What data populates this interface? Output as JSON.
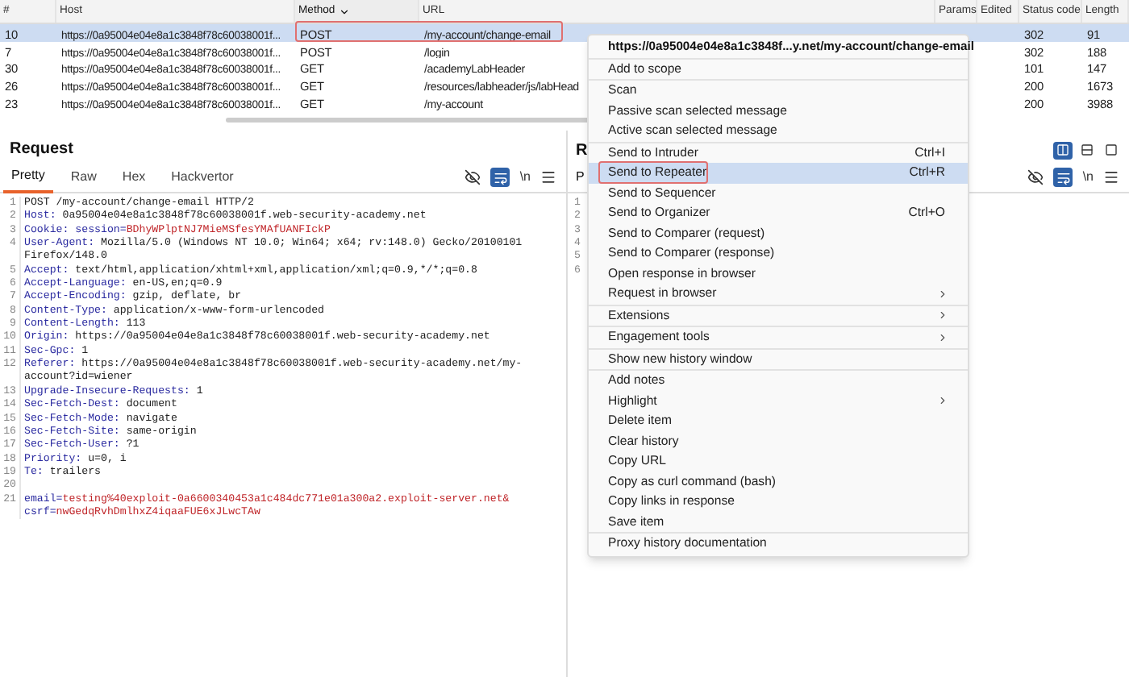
{
  "table": {
    "columns": [
      {
        "label": "#",
        "sorted": false
      },
      {
        "label": "Host",
        "sorted": false
      },
      {
        "label": "Method",
        "sorted": true
      },
      {
        "label": "URL",
        "sorted": false
      },
      {
        "label": "Params",
        "sorted": false
      },
      {
        "label": "Edited",
        "sorted": false
      },
      {
        "label": "Status code",
        "sorted": false
      },
      {
        "label": "Length",
        "sorted": false
      }
    ],
    "rows": [
      {
        "cells": [
          "10",
          "https://0a95004e04e8a1c3848f78c60038001f...",
          "POST",
          "/my-account/change-email",
          "",
          "",
          "302",
          "91"
        ],
        "selected": true,
        "boxed": true
      },
      {
        "cells": [
          "7",
          "https://0a95004e04e8a1c3848f78c60038001f...",
          "POST",
          "/login",
          "",
          "",
          "302",
          "188"
        ],
        "selected": false,
        "boxed": false
      },
      {
        "cells": [
          "30",
          "https://0a95004e04e8a1c3848f78c60038001f...",
          "GET",
          "/academyLabHeader",
          "",
          "",
          "101",
          "147"
        ],
        "selected": false,
        "boxed": false
      },
      {
        "cells": [
          "26",
          "https://0a95004e04e8a1c3848f78c60038001f...",
          "GET",
          "/resources/labheader/js/labHead",
          "",
          "",
          "200",
          "1673"
        ],
        "selected": false,
        "boxed": false
      },
      {
        "cells": [
          "23",
          "https://0a95004e04e8a1c3848f78c60038001f...",
          "GET",
          "/my-account",
          "",
          "",
          "200",
          "3988"
        ],
        "selected": false,
        "boxed": false
      }
    ]
  },
  "request": {
    "title": "Request",
    "tabs": [
      {
        "label": "Pretty",
        "selected": true
      },
      {
        "label": "Raw",
        "selected": false
      },
      {
        "label": "Hex",
        "selected": false
      },
      {
        "label": "Hackvertor",
        "selected": false
      }
    ],
    "newline_toggle": "\\n",
    "lines": [
      {
        "number": "1",
        "segments": [
          {
            "kind": "plain",
            "text": "POST /my-account/change-email HTTP/2"
          }
        ]
      },
      {
        "number": "2",
        "segments": [
          {
            "kind": "name",
            "text": "Host:"
          },
          {
            "kind": "plain",
            "text": " 0a95004e04e8a1c3848f78c60038001f.web-security-academy.net"
          }
        ]
      },
      {
        "number": "3",
        "segments": [
          {
            "kind": "name",
            "text": "Cookie:"
          },
          {
            "kind": "name",
            "text": " session="
          },
          {
            "kind": "value",
            "text": "BDhyWPlptNJ7MieMSfesYMAfUANFIckP"
          }
        ]
      },
      {
        "number": "4",
        "segments": [
          {
            "kind": "name",
            "text": "User-Agent:"
          },
          {
            "kind": "plain",
            "text": " Mozilla/5.0 (Windows NT 10.0; Win64; x64; rv:148.0) Gecko/20100101 Firefox/148.0"
          }
        ]
      },
      {
        "number": "5",
        "segments": [
          {
            "kind": "name",
            "text": "Accept:"
          },
          {
            "kind": "plain",
            "text": " text/html,application/xhtml+xml,application/xml;q=0.9,*/*;q=0.8"
          }
        ]
      },
      {
        "number": "6",
        "segments": [
          {
            "kind": "name",
            "text": "Accept-Language:"
          },
          {
            "kind": "plain",
            "text": " en-US,en;q=0.9"
          }
        ]
      },
      {
        "number": "7",
        "segments": [
          {
            "kind": "name",
            "text": "Accept-Encoding:"
          },
          {
            "kind": "plain",
            "text": " gzip, deflate, br"
          }
        ]
      },
      {
        "number": "8",
        "segments": [
          {
            "kind": "name",
            "text": "Content-Type:"
          },
          {
            "kind": "plain",
            "text": " application/x-www-form-urlencoded"
          }
        ]
      },
      {
        "number": "9",
        "segments": [
          {
            "kind": "name",
            "text": "Content-Length:"
          },
          {
            "kind": "plain",
            "text": " 113"
          }
        ]
      },
      {
        "number": "10",
        "segments": [
          {
            "kind": "name",
            "text": "Origin:"
          },
          {
            "kind": "plain",
            "text": " https://0a95004e04e8a1c3848f78c60038001f.web-security-academy.net"
          }
        ]
      },
      {
        "number": "11",
        "segments": [
          {
            "kind": "name",
            "text": "Sec-Gpc:"
          },
          {
            "kind": "plain",
            "text": " 1"
          }
        ]
      },
      {
        "number": "12",
        "segments": [
          {
            "kind": "name",
            "text": "Referer:"
          },
          {
            "kind": "plain",
            "text": " https://0a95004e04e8a1c3848f78c60038001f.web-security-academy.net/my-account?id=wiener"
          }
        ]
      },
      {
        "number": "13",
        "segments": [
          {
            "kind": "name",
            "text": "Upgrade-Insecure-Requests:"
          },
          {
            "kind": "plain",
            "text": " 1"
          }
        ]
      },
      {
        "number": "14",
        "segments": [
          {
            "kind": "name",
            "text": "Sec-Fetch-Dest:"
          },
          {
            "kind": "plain",
            "text": " document"
          }
        ]
      },
      {
        "number": "15",
        "segments": [
          {
            "kind": "name",
            "text": "Sec-Fetch-Mode:"
          },
          {
            "kind": "plain",
            "text": " navigate"
          }
        ]
      },
      {
        "number": "16",
        "segments": [
          {
            "kind": "name",
            "text": "Sec-Fetch-Site:"
          },
          {
            "kind": "plain",
            "text": " same-origin"
          }
        ]
      },
      {
        "number": "17",
        "segments": [
          {
            "kind": "name",
            "text": "Sec-Fetch-User:"
          },
          {
            "kind": "plain",
            "text": " ?1"
          }
        ]
      },
      {
        "number": "18",
        "segments": [
          {
            "kind": "name",
            "text": "Priority:"
          },
          {
            "kind": "plain",
            "text": " u=0, i"
          }
        ]
      },
      {
        "number": "19",
        "segments": [
          {
            "kind": "name",
            "text": "Te:"
          },
          {
            "kind": "plain",
            "text": " trailers"
          }
        ]
      },
      {
        "number": "20"
      },
      {
        "number": "21",
        "segments": [
          {
            "kind": "name",
            "text": "email="
          },
          {
            "kind": "value",
            "text": "testing%40exploit-0a6600340453a1c484dc771e01a300a2.exploit-server.net&"
          }
        ]
      },
      {
        "segments": [
          {
            "kind": "name",
            "text": "csrf="
          },
          {
            "kind": "value",
            "text": "nwGedqRvhDmlhxZ4iqaaFUE6xJLwcTAw"
          }
        ]
      }
    ]
  },
  "response": {
    "title": "R",
    "tab": "P",
    "newline_toggle": "\\n",
    "line_numbers": [
      "1",
      "2",
      "3",
      "4",
      "5",
      "6"
    ],
    "layout_options": [
      {
        "kind": "columns",
        "selected": true
      },
      {
        "kind": "rows",
        "selected": false
      },
      {
        "kind": "single",
        "selected": false
      }
    ]
  },
  "context_menu": {
    "groups": [
      [
        {
          "label": "https://0a95004e04e8a1c3848f...y.net/my-account/change-email",
          "kind": "header"
        }
      ],
      [
        {
          "label": "Add to scope",
          "kind": "item",
          "selected": false
        }
      ],
      [
        {
          "label": "Scan",
          "kind": "item",
          "selected": false
        },
        {
          "label": "Passive scan selected message",
          "kind": "item",
          "selected": false
        },
        {
          "label": "Active scan selected message",
          "kind": "item",
          "selected": false
        }
      ],
      [
        {
          "label": "Send to Intruder",
          "kind": "item",
          "shortcut": "Ctrl+I",
          "selected": false
        },
        {
          "label": "Send to Repeater",
          "kind": "item",
          "shortcut": "Ctrl+R",
          "selected": true
        },
        {
          "label": "Send to Sequencer",
          "kind": "item",
          "selected": false
        },
        {
          "label": "Send to Organizer",
          "kind": "item",
          "shortcut": "Ctrl+O",
          "selected": false
        },
        {
          "label": "Send to Comparer (request)",
          "kind": "item",
          "selected": false
        },
        {
          "label": "Send to Comparer (response)",
          "kind": "item",
          "selected": false
        },
        {
          "label": "Open response in browser",
          "kind": "item",
          "selected": false
        },
        {
          "label": "Request in browser",
          "kind": "submenu",
          "selected": false
        }
      ],
      [
        {
          "label": "Extensions",
          "kind": "submenu",
          "selected": false
        }
      ],
      [
        {
          "label": "Engagement tools",
          "kind": "submenu",
          "selected": false
        }
      ],
      [
        {
          "label": "Show new history window",
          "kind": "item",
          "selected": false
        }
      ],
      [
        {
          "label": "Add notes",
          "kind": "item",
          "selected": false
        },
        {
          "label": "Highlight",
          "kind": "submenu",
          "selected": false
        },
        {
          "label": "Delete item",
          "kind": "item",
          "selected": false
        },
        {
          "label": "Clear history",
          "kind": "item",
          "selected": false
        },
        {
          "label": "Copy URL",
          "kind": "item",
          "selected": false
        },
        {
          "label": "Copy as curl command (bash)",
          "kind": "item",
          "selected": false
        },
        {
          "label": "Copy links in response",
          "kind": "item",
          "selected": false
        },
        {
          "label": "Save item",
          "kind": "item",
          "selected": false
        }
      ],
      [
        {
          "label": "Proxy history documentation",
          "kind": "item",
          "selected": false
        }
      ]
    ]
  }
}
